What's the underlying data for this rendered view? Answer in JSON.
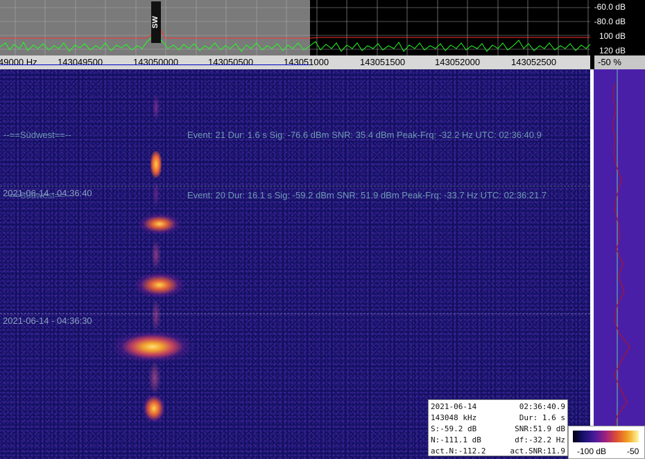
{
  "spectrum": {
    "db_labels": [
      "-60.0 dB",
      "-80.0 dB",
      "100 dB",
      "120 dB"
    ],
    "marker_label": "SW"
  },
  "freq_axis": {
    "ticks": [
      "49000 Hz",
      "143049500",
      "143050000",
      "143050500",
      "143051000",
      "143051500",
      "143052000",
      "143052500"
    ],
    "percent": "-50 %"
  },
  "waterfall": {
    "time_labels": [
      "2021-06-14 - 04:36:40",
      "2021-06-14 - 04:36:30"
    ],
    "station_labels": [
      "--==Südwest==--",
      "--==Südwest==--"
    ],
    "events": [
      {
        "text": "Event: 21   Dur: 1.6 s   Sig: -76.6 dBm   SNR: 35.4 dBm   Peak-Frq: -32.2 Hz   UTC: 02:36:40.9"
      },
      {
        "text": "Event: 20   Dur: 16.1 s   Sig: -59.2 dBm   SNR: 51.9 dBm   Peak-Frq: -33.7 Hz   UTC: 02:36:21.7"
      }
    ]
  },
  "info_box": {
    "rows": [
      [
        "2021-06-14",
        "02:36:40.9"
      ],
      [
        "143048 kHz",
        "Dur: 1.6 s"
      ],
      [
        "S:-59.2 dB",
        "SNR:51.9 dB"
      ],
      [
        "N:-111.1 dB",
        "df:-32.2 Hz"
      ],
      [
        "act.N:-112.2",
        "act.SNR:11.9"
      ]
    ]
  },
  "color_scale": {
    "min_label": "-100 dB",
    "max_label": "-50"
  },
  "colors": {
    "background": "#141060",
    "spectrum_trace": "#22ff22",
    "threshold_line": "#ff3030",
    "signal_hot": "#ffd24a",
    "level_panel": "#4a1fa8"
  }
}
